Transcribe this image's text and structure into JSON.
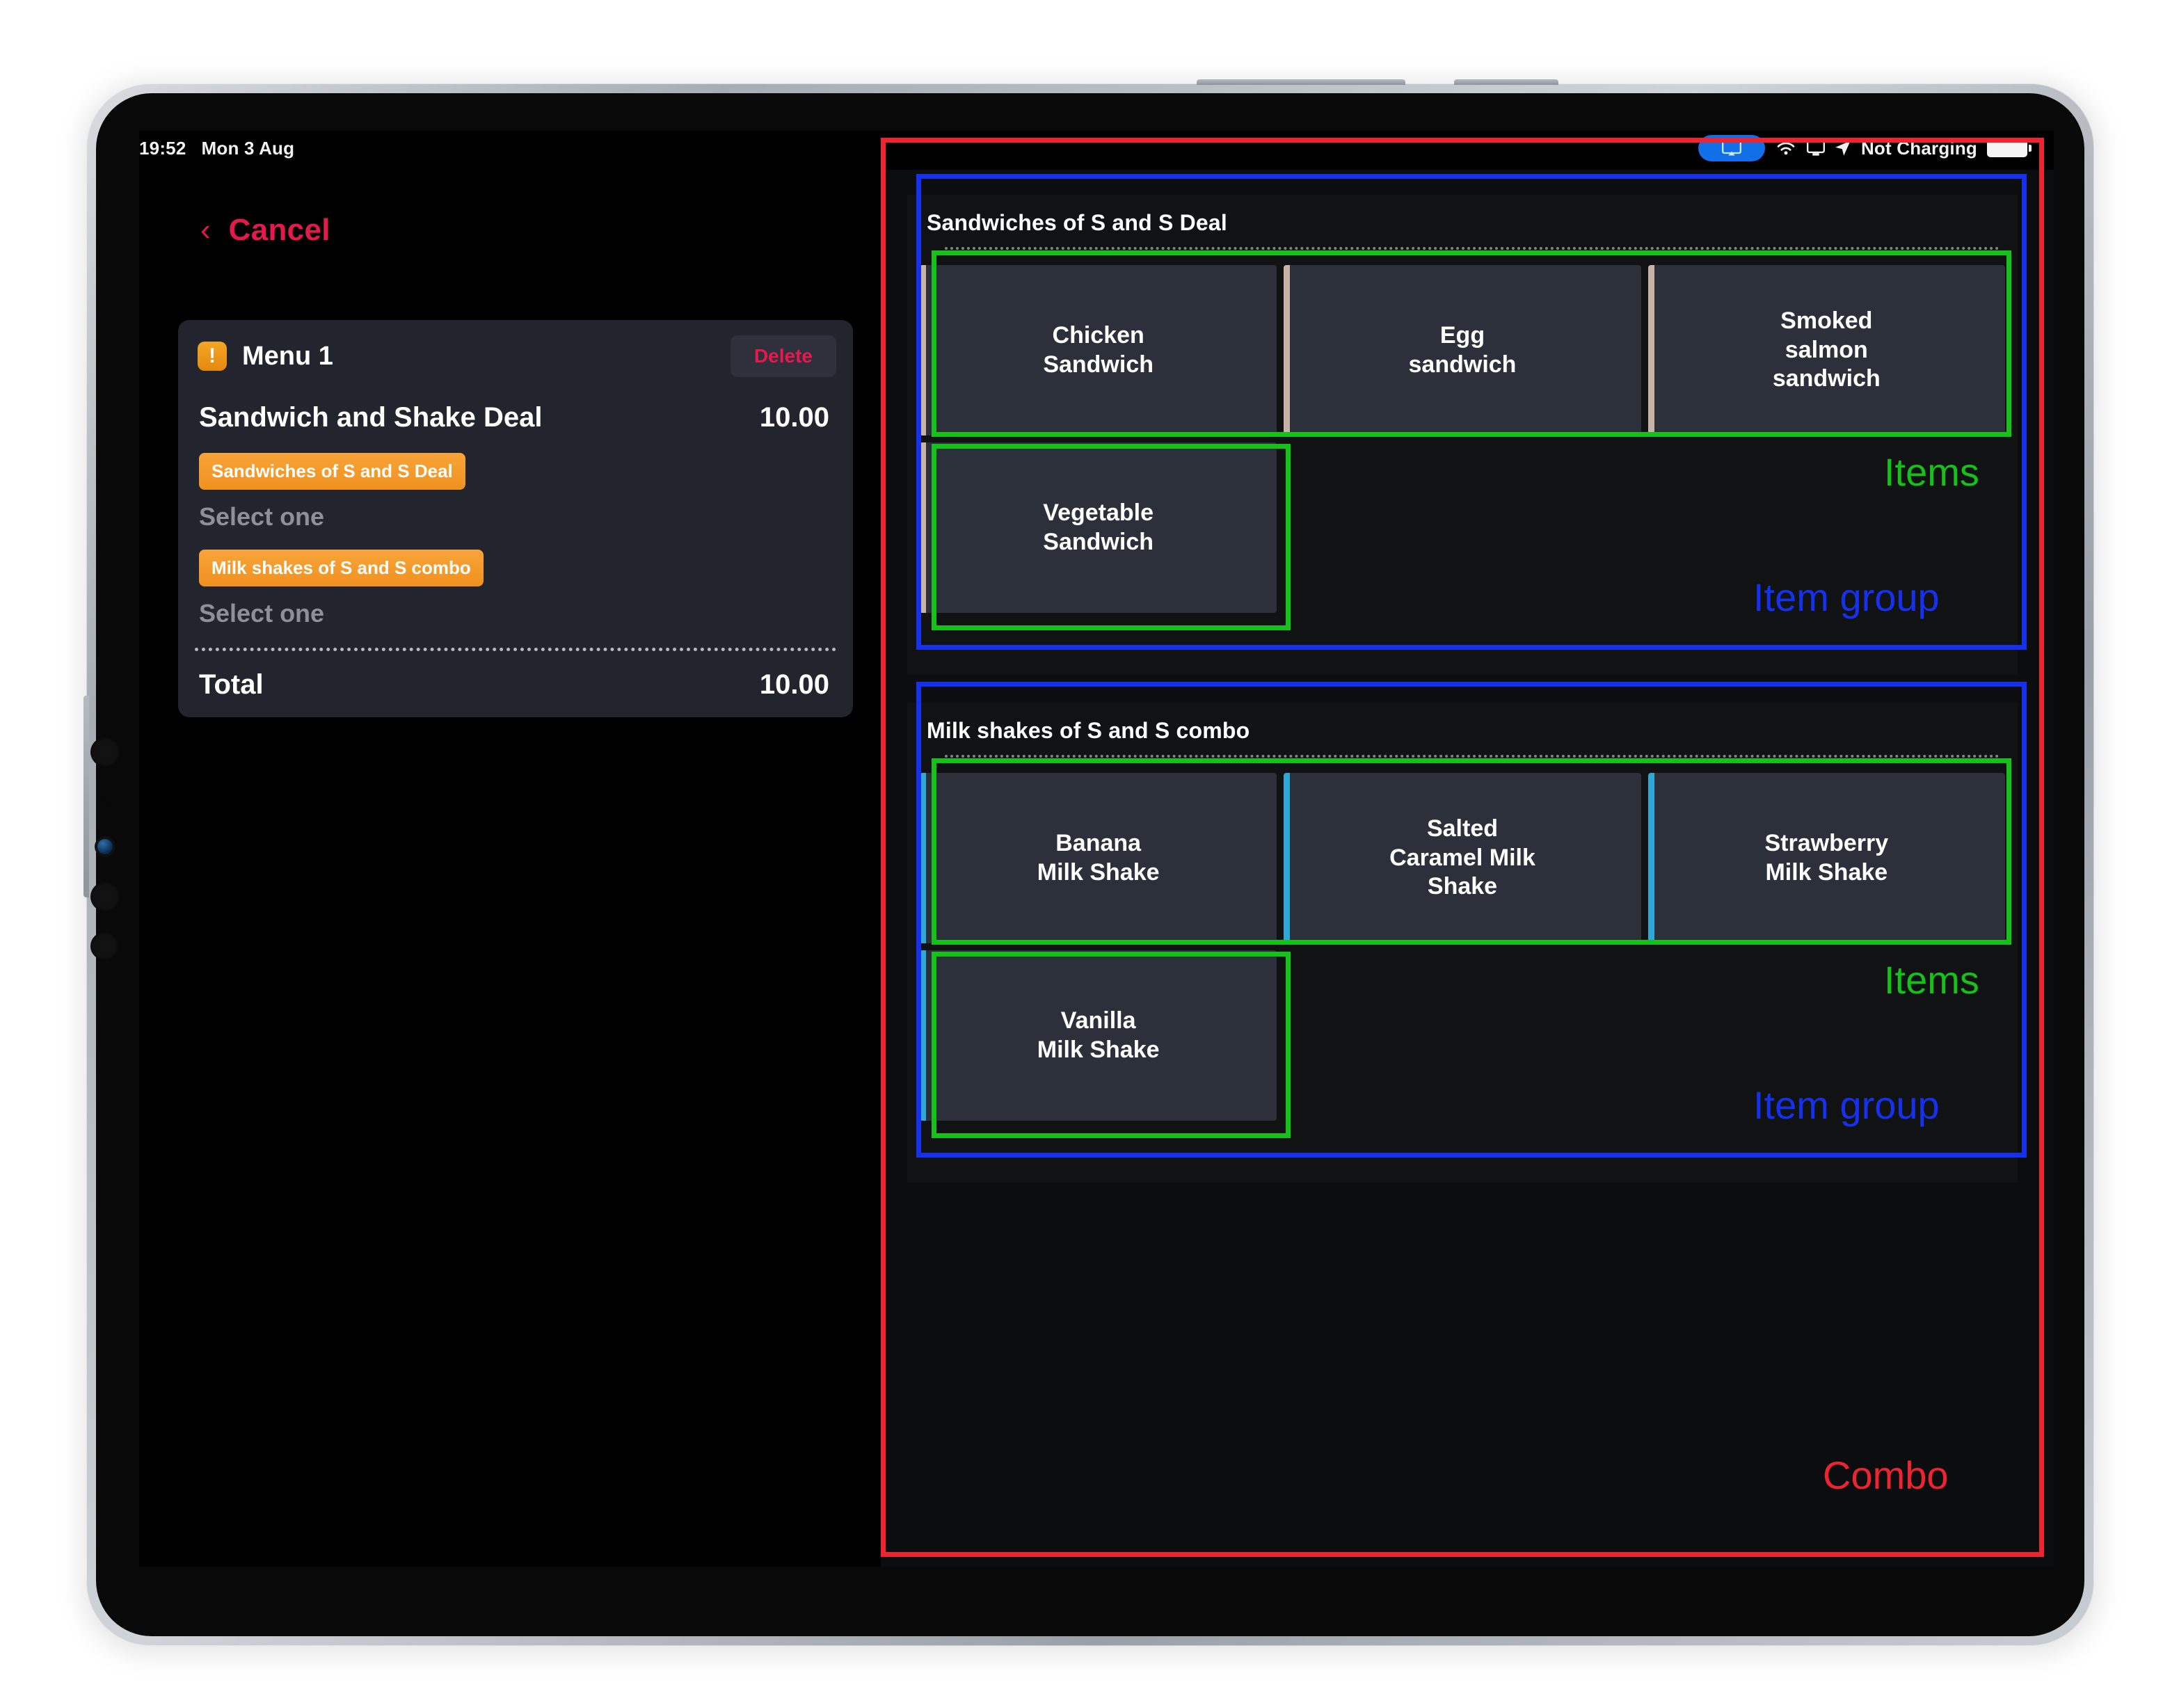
{
  "status_bar": {
    "time": "19:52",
    "date": "Mon 3 Aug",
    "mirror_icon": "screen-mirroring-icon",
    "wifi_icon": "wifi-icon",
    "airplay_icon": "screen-icon",
    "location_icon": "location-arrow-icon",
    "charging_text": "Not Charging",
    "battery_icon": "battery-icon"
  },
  "nav": {
    "back_icon": "chevron-left-icon",
    "cancel_label": "Cancel"
  },
  "order_card": {
    "warn_icon": "warning-icon",
    "menu_title": "Menu 1",
    "delete_label": "Delete",
    "deal_name": "Sandwich and Shake Deal",
    "deal_price": "10.00",
    "modifier_groups": [
      {
        "chip_label": "Sandwiches of S and S Deal",
        "hint": "Select one"
      },
      {
        "chip_label": "Milk shakes of S and S combo",
        "hint": "Select one"
      }
    ],
    "total_label": "Total",
    "total_value": "10.00"
  },
  "item_groups": [
    {
      "title": "Sandwiches of S and S Deal",
      "accent_color": "#c8b4a6",
      "items": [
        {
          "label": "Chicken\nSandwich"
        },
        {
          "label": "Egg\nsandwich"
        },
        {
          "label": "Smoked\nsalmon\nsandwich"
        },
        {
          "label": "Vegetable\nSandwich"
        }
      ]
    },
    {
      "title": "Milk shakes of S and S combo",
      "accent_color": "#2fa8d8",
      "items": [
        {
          "label": "Banana\nMilk Shake"
        },
        {
          "label": "Salted\nCaramel Milk\nShake"
        },
        {
          "label": "Strawberry\nMilk Shake"
        },
        {
          "label": "Vanilla\nMilk Shake"
        }
      ]
    }
  ],
  "annotations": {
    "items_label": "Items",
    "item_group_label": "Item group",
    "combo_label": "Combo",
    "colors": {
      "items": "#16c21a",
      "item_group": "#1531ed",
      "combo": "#ef2431"
    }
  }
}
